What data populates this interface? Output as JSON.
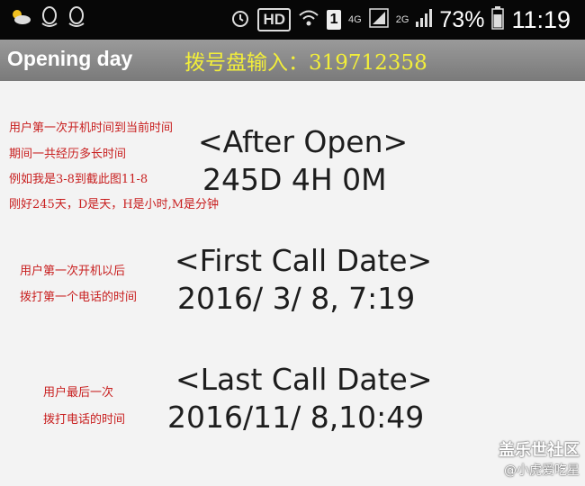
{
  "status_bar": {
    "hd_badge": "HD",
    "sim_number": "1",
    "network_4g": "4G",
    "network_2g": "2G",
    "battery_percent": "73%",
    "clock": "11:19",
    "icons": [
      "weather-icon",
      "qq-icon",
      "qq-icon",
      "alarm-icon",
      "wifi-icon",
      "signal-icon",
      "battery-icon"
    ]
  },
  "app_bar": {
    "title": "Opening day",
    "dial_input": "拨号盘输入：319712358"
  },
  "sections": {
    "after_open": {
      "label": "<After Open>",
      "value": "245D 4H 0M",
      "notes": [
        "用户第一次开机时间到当前时间",
        "期间一共经历多长时间",
        "例如我是3-8到截此图11-8",
        "刚好245天，D是天，H是小时,M是分钟"
      ]
    },
    "first_call": {
      "label": "<First Call Date>",
      "value": "2016/ 3/ 8, 7:19",
      "notes": [
        "用户第一次开机以后",
        "拨打第一个电话的时间"
      ]
    },
    "last_call": {
      "label": "<Last Call Date>",
      "value": "2016/11/ 8,10:49",
      "notes": [
        "用户最后一次",
        "拨打电话的时间"
      ]
    }
  },
  "watermark": {
    "line1": "盖乐世社区",
    "line2": "@小虎爱吃星"
  },
  "colors": {
    "status_bg": "#070707",
    "title_bar": "#8a8a8a",
    "dial_text": "#f2ee3a",
    "note_red": "#c81e1e",
    "body_bg": "#f3f3f3"
  }
}
